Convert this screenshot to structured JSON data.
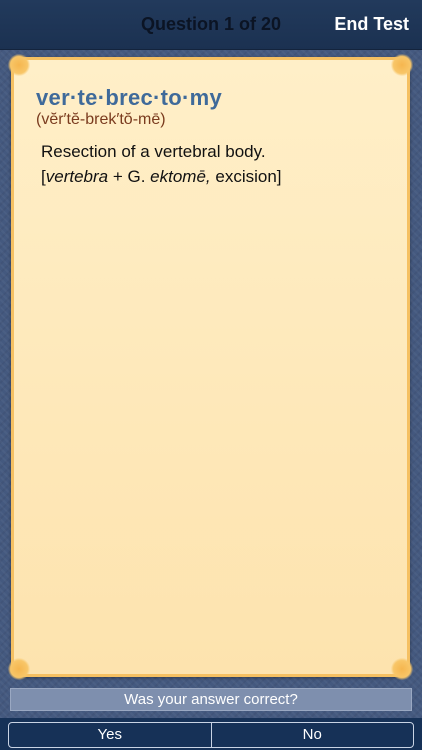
{
  "header": {
    "title": "Question 1 of 20",
    "end_test_label": "End Test"
  },
  "card": {
    "term": "ver·te·brec·to·my",
    "pronunciation": "(vĕr′tĕ-brek′tŏ-mē)",
    "definition": "Resection of a vertebral body.",
    "etymology": {
      "open": "[",
      "word": "vertebra",
      "plus": " + G. ",
      "greek": "ektomē,",
      "rest": " excision]"
    }
  },
  "footer": {
    "prompt": "Was your answer correct?",
    "yes_label": "Yes",
    "no_label": "No"
  }
}
